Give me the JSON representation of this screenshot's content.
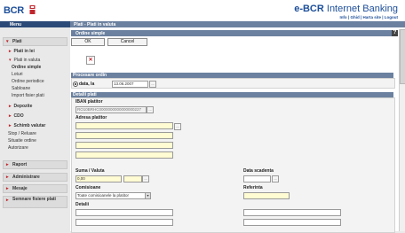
{
  "header": {
    "logo_text": "BCR",
    "app_title_bold": "e-BCR",
    "app_title_light": " Internet Banking",
    "links": [
      "Info",
      "Ghid",
      "Harta site",
      "Logout"
    ],
    "link_separator": " | "
  },
  "menu_label": "Menu",
  "breadcrumb": "Plati - Plati in valuta",
  "sidebar": {
    "plati": "Plati",
    "plati_in_lei": "Plati in lei",
    "plati_in_valuta": "Plati in valuta",
    "links": [
      "Ordine simple",
      "Loturi",
      "Ordine periodice",
      "Sabloane",
      "Import fisier plati"
    ],
    "depozite": "Depozite",
    "cdo": "CDO",
    "schimb_valutar": "Schimb valutar",
    "plain": [
      "Stop / Reluare",
      "Situatie ordine",
      "Autorizare"
    ],
    "raport": "Raport",
    "administrare": "Administrare",
    "mesaje": "Mesaje",
    "semnare": "Semnare fisiere plati"
  },
  "form": {
    "title": "Ordine simple",
    "help": "?",
    "ok_label": "OK",
    "cancel_label": "Cancel",
    "close_glyph": "✕",
    "procesare_title": "Procesare ordin",
    "date_label": "data, la",
    "date_value": "13.06.2007",
    "detalii_title": "Detalii plati",
    "iban_label": "IBAN platitor",
    "iban_value": "RO10BRHC0000000000000000227",
    "adresa_label": "Adresa platitor",
    "suma_label": "Suma / Valuta",
    "suma_value": "0,00",
    "data_scadenta_label": "Data scadenta",
    "comisioane_label": "Comisioane",
    "comisioane_value": "Toate comisioanele la platitor",
    "referinta_label": "Referinta",
    "detalii_label": "Detalii",
    "lookup_glyph": "..."
  }
}
